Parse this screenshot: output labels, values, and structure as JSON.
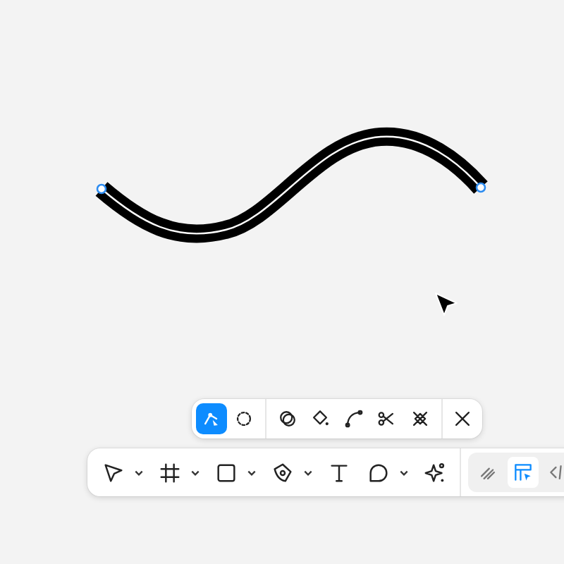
{
  "canvas": {
    "path": {
      "selected": true
    }
  },
  "edit_toolbar": {
    "groups": [
      {
        "tools": [
          {
            "kind": "edit-path",
            "selected": true
          },
          {
            "kind": "lasso",
            "selected": false
          }
        ]
      },
      {
        "tools": [
          {
            "kind": "boolean",
            "selected": false
          },
          {
            "kind": "paint-bucket",
            "selected": false
          },
          {
            "kind": "bend",
            "selected": false
          },
          {
            "kind": "cut",
            "selected": false
          },
          {
            "kind": "shape-builder",
            "selected": false
          }
        ]
      },
      {
        "tools": [
          {
            "kind": "close",
            "selected": false
          }
        ]
      }
    ]
  },
  "main_toolbar": {
    "tools": [
      {
        "kind": "move",
        "selected": false,
        "menu": true
      },
      {
        "kind": "frame",
        "selected": false,
        "menu": true
      },
      {
        "kind": "rectangle",
        "selected": false,
        "menu": true
      },
      {
        "kind": "pen",
        "selected": false,
        "menu": true
      },
      {
        "kind": "text",
        "selected": false,
        "menu": false
      },
      {
        "kind": "comment",
        "selected": false,
        "menu": true
      },
      {
        "kind": "actions",
        "selected": false,
        "menu": false
      }
    ],
    "modes": [
      {
        "kind": "draw",
        "selected": false
      },
      {
        "kind": "design",
        "selected": true
      },
      {
        "kind": "code",
        "selected": false
      }
    ]
  }
}
